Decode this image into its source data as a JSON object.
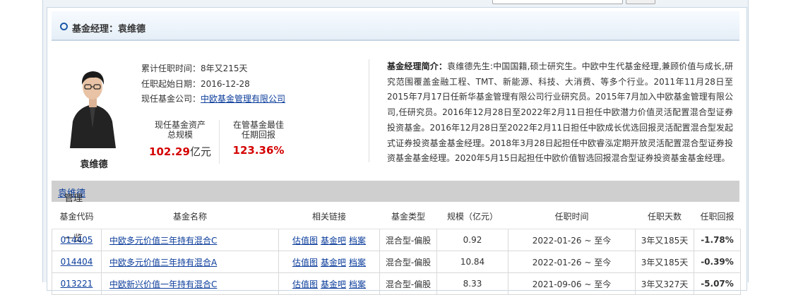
{
  "header": {
    "title": "基金经理：袁维德"
  },
  "manager": {
    "name": "袁维德",
    "tenure_label": "累计任职时间：",
    "tenure_value": "8年又215天",
    "start_label": "任职起始日期：",
    "start_value": "2016-12-28",
    "company_label": "现任基金公司：",
    "company_value": "中欧基金管理有限公司",
    "asset_label_1": "现任基金资产",
    "asset_label_2": "总规模",
    "asset_value": "102.29",
    "asset_unit": "亿元",
    "best_label_1": "在管基金最佳",
    "best_label_2": "任期回报",
    "best_value": "123.36%"
  },
  "bio": {
    "label": "基金经理简介：",
    "text": "袁维德先生:中国国籍,硕士研究生。中欧中生代基金经理,兼顾价值与成长,研究范围覆盖金融工程、TMT、新能源、科技、大消费、等多个行业。2011年11月28日至2015年7月17日任新华基金管理有限公司行业研究员。2015年7月加入中欧基金管理有限公司,任研究员。2016年12月28日至2022年2月11日担任中欧潜力价值灵活配置混合型证券投资基金。2016年12月28日至2022年2月11日担任中欧成长优选回报灵活配置混合型发起式证券投资基金基金经理。2018年3月28日起担任中欧睿泓定期开放灵活配置混合型证券投资基金基金经理。2020年5月15日起担任中欧价值智选回报混合型证券投资基金基金经理。"
  },
  "list": {
    "manager_link": "袁维德",
    "title_suffix": "管理过的基金一览"
  },
  "table": {
    "headers": {
      "code": "基金代码",
      "name": "基金名称",
      "links": "相关链接",
      "type": "基金类型",
      "scale": "规模（亿元）",
      "period": "任职时间",
      "days": "任职天数",
      "ret": "任职回报"
    },
    "link_labels": [
      "估值图",
      "基金吧",
      "档案"
    ],
    "rows": [
      {
        "code": "014405",
        "name": "中欧多元价值三年持有混合C",
        "type": "混合型-偏股",
        "scale": "0.92",
        "period": "2022-01-26 ~ 至今",
        "days": "3年又185天",
        "ret": "-1.78%"
      },
      {
        "code": "014404",
        "name": "中欧多元价值三年持有混合A",
        "type": "混合型-偏股",
        "scale": "10.84",
        "period": "2022-01-26 ~ 至今",
        "days": "3年又185天",
        "ret": "-0.39%"
      },
      {
        "code": "013221",
        "name": "中欧新兴价值一年持有混合C",
        "type": "混合型-偏股",
        "scale": "8.33",
        "period": "2021-09-06 ~ 至今",
        "days": "3年又327天",
        "ret": "-5.07%"
      }
    ]
  },
  "colors": {
    "link": "#0b3d9b",
    "highlight": "#d40000",
    "negative": "#0a8a1a"
  }
}
